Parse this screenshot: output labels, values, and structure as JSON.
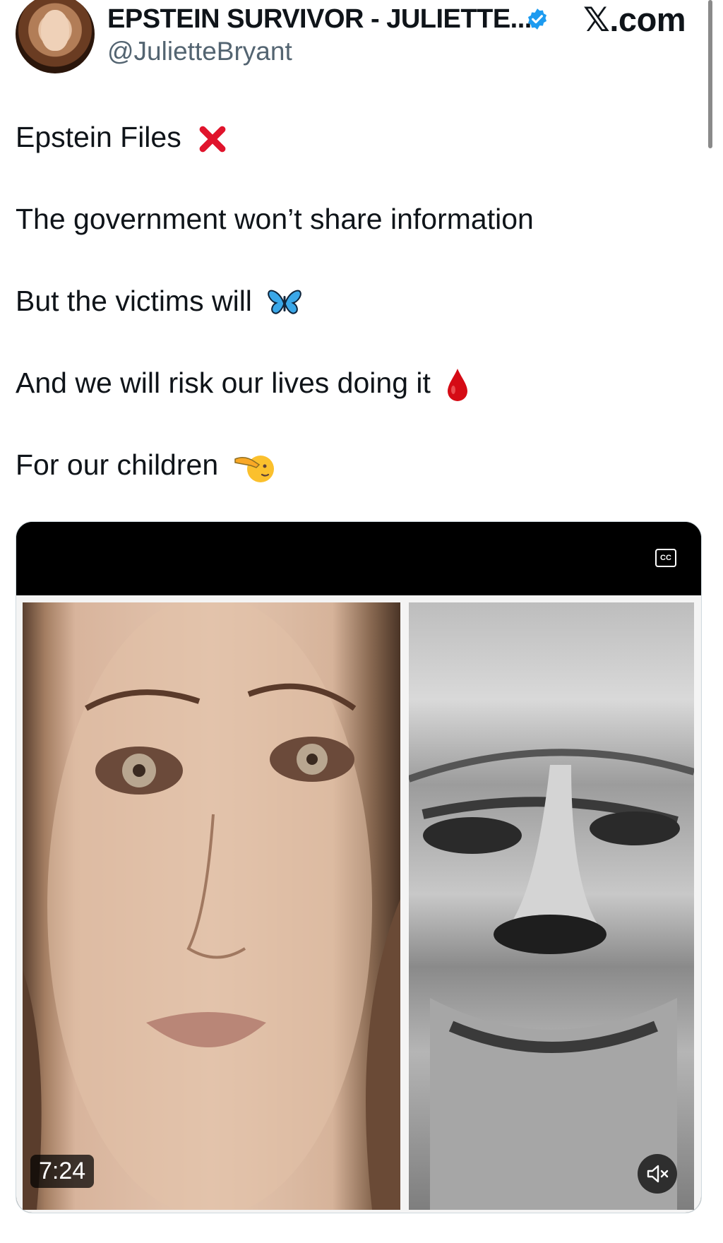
{
  "author": {
    "display_name": "EPSTEIN SURVIVOR - JULIETTE...",
    "handle": "@JulietteBryant",
    "verified_color": "#1d9bf0"
  },
  "site": {
    "logo_text": "𝕏.com"
  },
  "tweet": {
    "lines": [
      {
        "text": "Epstein Files",
        "emoji": "cross-mark-icon"
      },
      {
        "text": "The government won’t share information",
        "emoji": ""
      },
      {
        "text": "But the victims will",
        "emoji": "butterfly-icon"
      },
      {
        "text": "And we will risk our lives doing it",
        "emoji": "drop-of-blood-icon"
      },
      {
        "text": "For our children",
        "emoji": "saluting-face-icon"
      }
    ]
  },
  "media": {
    "captions_label": "CC",
    "duration": "7:24",
    "mute_icon": "speaker-muted-icon"
  },
  "colors": {
    "text": "#0f1419",
    "muted_text": "#536471",
    "verified": "#1d9bf0",
    "cross": "#e0142c",
    "blood": "#d50b15"
  }
}
